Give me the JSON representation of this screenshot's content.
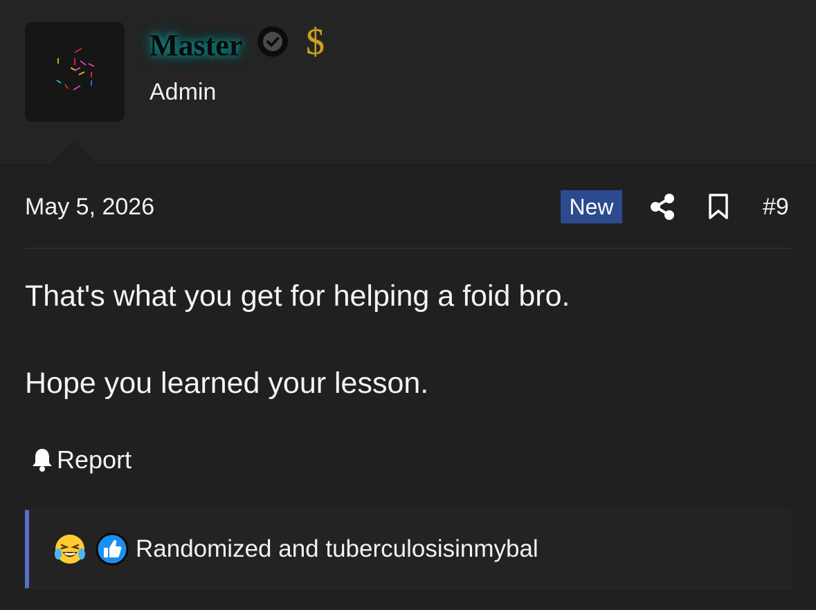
{
  "author": {
    "username": "Master",
    "role": "Admin",
    "dollar_badge": "$",
    "verified_icon": "verified-check-icon"
  },
  "post": {
    "date": "May 5, 2026",
    "new_badge": "New",
    "number": "#9",
    "lines": [
      "That's what you get for helping a foid bro.",
      "Hope you learned your lesson."
    ],
    "report_label": "Report"
  },
  "reactions": {
    "icons": [
      "laughing-crying-emoji",
      "thumbs-up-emoji"
    ],
    "names": "Randomized and tuberculosisinmybal"
  },
  "colors": {
    "background": "#202020",
    "header_background": "#242424",
    "new_badge": "#2c4a8e",
    "reaction_accent": "#5b6fc8",
    "username_glow": "#0f8f8f",
    "dollar": "#c9a227"
  }
}
